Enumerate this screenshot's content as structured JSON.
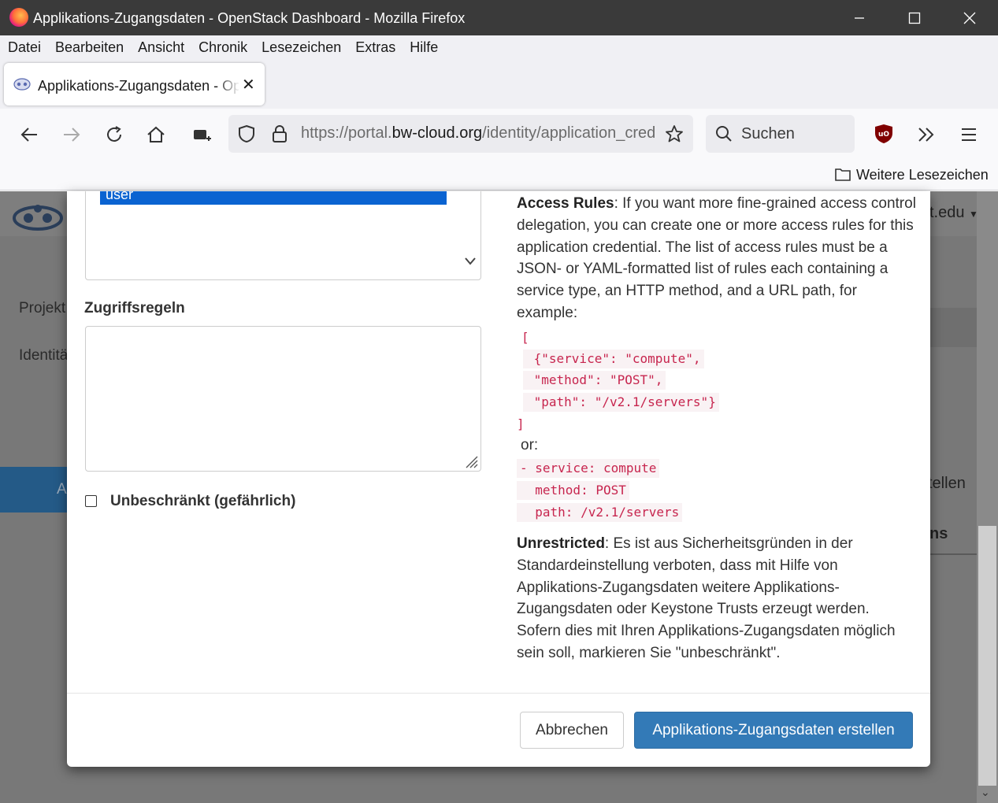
{
  "window": {
    "title": "Applikations-Zugangsdaten - OpenStack Dashboard - Mozilla Firefox"
  },
  "menu": [
    "Datei",
    "Bearbeiten",
    "Ansicht",
    "Chronik",
    "Lesezeichen",
    "Extras",
    "Hilfe"
  ],
  "tab": {
    "title": "Applikations-Zugangsdaten - OpenStack Dashboard"
  },
  "urlbar": {
    "prefix": "https://portal.",
    "domain": "bw-cloud.org",
    "path": "/identity/application_credentials/create/"
  },
  "search": {
    "placeholder": "Suchen"
  },
  "bookmarks": {
    "other": "Weitere Lesezeichen"
  },
  "background": {
    "side_projekt": "Projekt",
    "side_identitat": "Identitä",
    "side_a": "A",
    "user_tail": "t.edu",
    "right_stellen": "tellen",
    "right_ns": "ns"
  },
  "form": {
    "selected_role": "user",
    "access_rules_label": "Zugriffsregeln",
    "unrestricted_label": "Unbeschränkt (gefährlich)"
  },
  "help": {
    "access_rules_title": "Access Rules",
    "access_rules_text": ": If you want more fine-grained access control delegation, you can create one or more access rules for this application credential. The list of access rules must be a JSON- or YAML-formatted list of rules each containing a service type, an HTTP method, and a URL path, for example:",
    "json_lines": [
      "[",
      " {\"service\": \"compute\",",
      " \"method\": \"POST\",",
      " \"path\": \"/v2.1/servers\"}",
      "]"
    ],
    "or": "or:",
    "yaml_lines": [
      "- service: compute",
      "  method: POST",
      "  path: /v2.1/servers"
    ],
    "unrestricted_title": "Unrestricted",
    "unrestricted_text": ": Es ist aus Sicherheitsgründen in der Standardeinstellung verboten, dass mit Hilfe von Applikations-Zugangsdaten weitere Applikations-Zugangsdaten oder Keystone Trusts erzeugt werden. Sofern dies mit Ihren Applikations-Zugangsdaten möglich sein soll, markieren Sie \"unbeschränkt\"."
  },
  "buttons": {
    "cancel": "Abbrechen",
    "create": "Applikations-Zugangsdaten erstellen"
  }
}
